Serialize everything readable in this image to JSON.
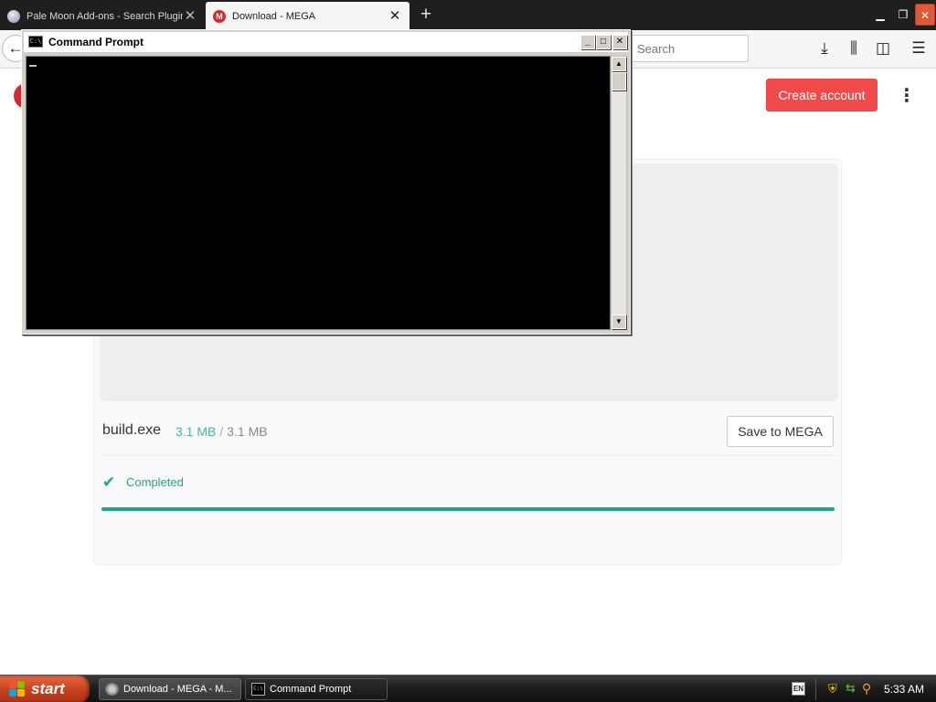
{
  "browser": {
    "tabs": [
      {
        "title": "Pale Moon Add-ons - Search Plugin",
        "active": false
      },
      {
        "title": "Download - MEGA",
        "active": true
      }
    ],
    "new_tab_label": "+",
    "search_placeholder": "Search",
    "icons": [
      "back-arrow-icon",
      "download-icon",
      "library-icon",
      "sidebar-icon",
      "hamburger-menu-icon"
    ]
  },
  "mega": {
    "create_account_label": "Create account",
    "file": {
      "name": "build.exe",
      "downloaded": "3.1 MB",
      "separator": "/",
      "total": "3.1 MB"
    },
    "save_to_mega_label": "Save to MEGA",
    "status": "Completed",
    "progress": 1.0,
    "accent_color": "#19a98a",
    "brand_color": "#f04a4a"
  },
  "cmd": {
    "title": "Command Prompt",
    "icon_text": "C:\\"
  },
  "taskbar": {
    "start_label": "start",
    "items": [
      {
        "label": "Download - MEGA - M..."
      },
      {
        "label": "Command Prompt"
      }
    ],
    "tray": {
      "lang": "EN",
      "clock": "5:33 AM"
    }
  }
}
